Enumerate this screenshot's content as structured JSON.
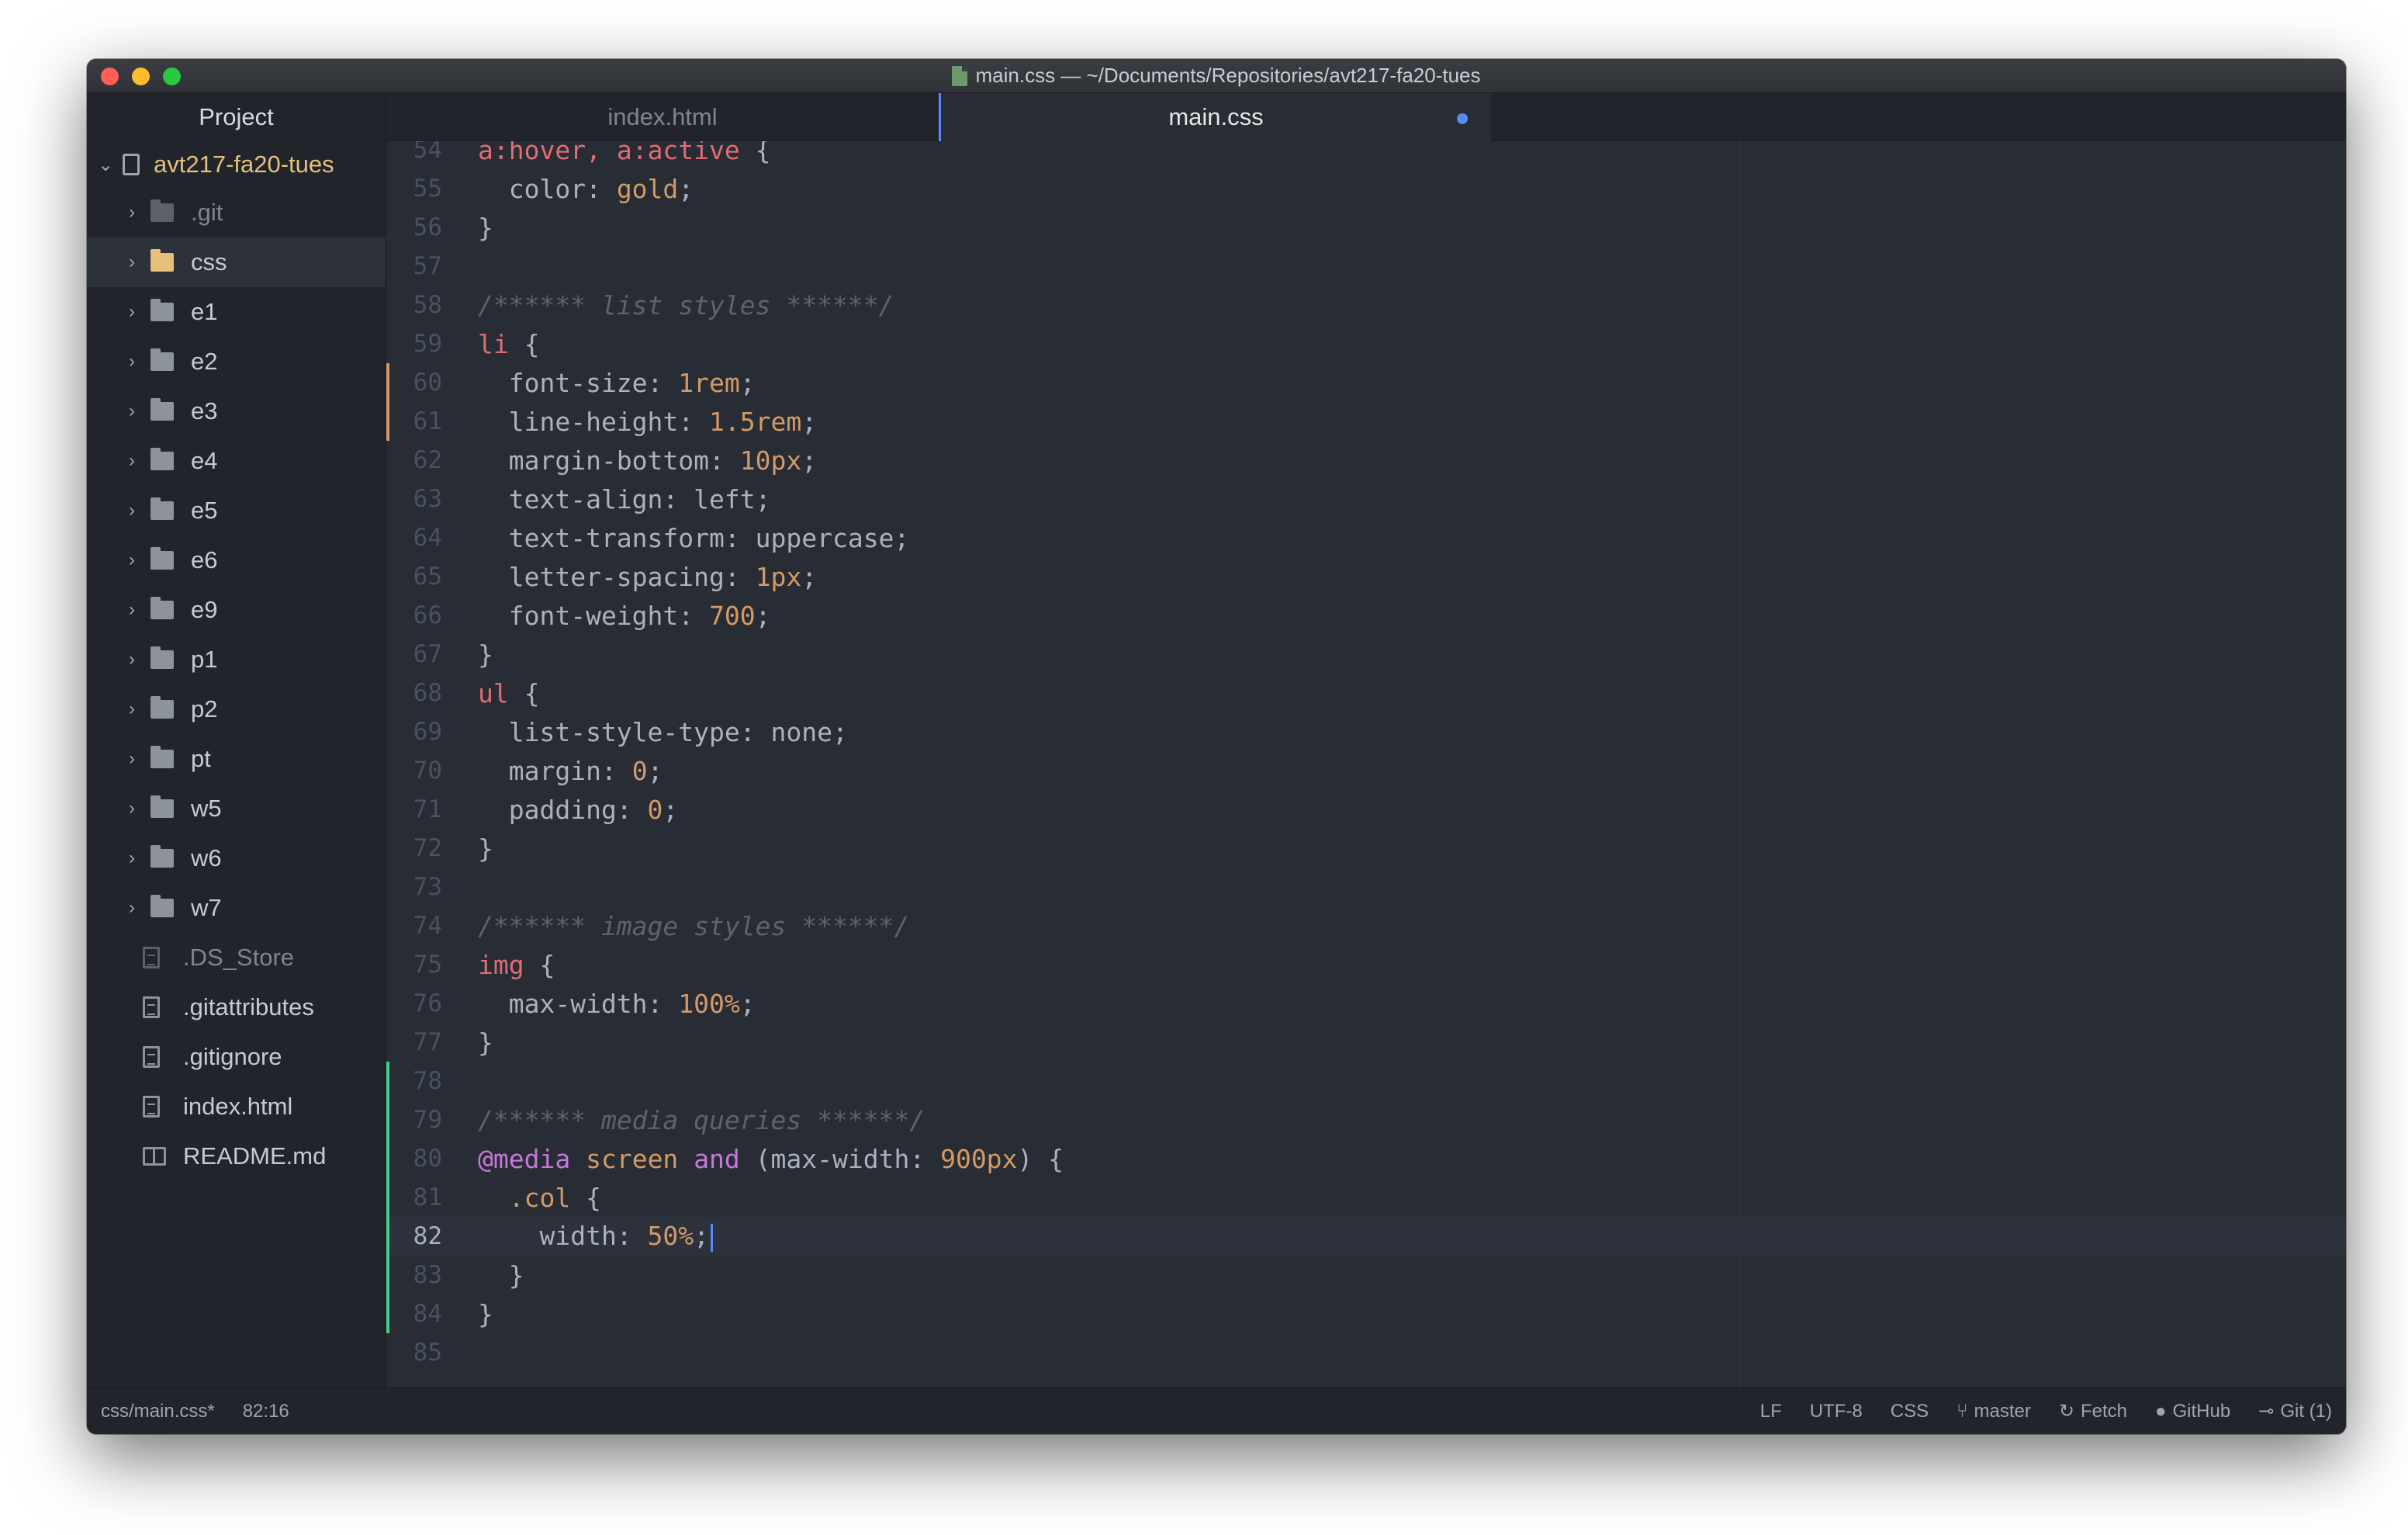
{
  "window": {
    "title": "main.css — ~/Documents/Repositories/avt217-fa20-tues"
  },
  "sidebar": {
    "header": "Project",
    "root": "avt217-fa20-tues",
    "folders": [
      ".git",
      "css",
      "e1",
      "e2",
      "e3",
      "e4",
      "e5",
      "e6",
      "e9",
      "p1",
      "p2",
      "pt",
      "w5",
      "w6",
      "w7"
    ],
    "files": [
      ".DS_Store",
      ".gitattributes",
      ".gitignore",
      "index.html",
      "README.md"
    ]
  },
  "tabs": [
    {
      "label": "index.html"
    },
    {
      "label": "main.css"
    }
  ],
  "editor": {
    "lines": [
      {
        "n": "54",
        "git": "",
        "tokens": [
          {
            "c": "t-sel",
            "t": "a:hover"
          },
          {
            "c": "t-sel",
            "t": ", "
          },
          {
            "c": "t-sel",
            "t": "a:active"
          },
          {
            "c": "",
            "t": " {"
          }
        ]
      },
      {
        "n": "55",
        "git": "",
        "tokens": [
          {
            "c": "",
            "t": "  color: "
          },
          {
            "c": "t-val",
            "t": "gold"
          },
          {
            "c": "",
            "t": ";"
          }
        ]
      },
      {
        "n": "56",
        "git": "",
        "tokens": [
          {
            "c": "",
            "t": "}"
          }
        ]
      },
      {
        "n": "57",
        "git": "",
        "tokens": []
      },
      {
        "n": "58",
        "git": "",
        "tokens": [
          {
            "c": "t-com",
            "t": "/****** list styles ******/"
          }
        ]
      },
      {
        "n": "59",
        "git": "",
        "tokens": [
          {
            "c": "t-sel",
            "t": "li"
          },
          {
            "c": "",
            "t": " {"
          }
        ]
      },
      {
        "n": "60",
        "git": "modified",
        "tokens": [
          {
            "c": "",
            "t": "  font-size: "
          },
          {
            "c": "t-val",
            "t": "1rem"
          },
          {
            "c": "",
            "t": ";"
          }
        ]
      },
      {
        "n": "61",
        "git": "modified",
        "tokens": [
          {
            "c": "",
            "t": "  line-height: "
          },
          {
            "c": "t-val",
            "t": "1.5rem"
          },
          {
            "c": "",
            "t": ";"
          }
        ]
      },
      {
        "n": "62",
        "git": "",
        "tokens": [
          {
            "c": "",
            "t": "  margin-bottom: "
          },
          {
            "c": "t-val",
            "t": "10px"
          },
          {
            "c": "",
            "t": ";"
          }
        ]
      },
      {
        "n": "63",
        "git": "",
        "tokens": [
          {
            "c": "",
            "t": "  text-align: left;"
          }
        ]
      },
      {
        "n": "64",
        "git": "",
        "tokens": [
          {
            "c": "",
            "t": "  text-transform: uppercase;"
          }
        ]
      },
      {
        "n": "65",
        "git": "",
        "tokens": [
          {
            "c": "",
            "t": "  letter-spacing: "
          },
          {
            "c": "t-val",
            "t": "1px"
          },
          {
            "c": "",
            "t": ";"
          }
        ]
      },
      {
        "n": "66",
        "git": "",
        "tokens": [
          {
            "c": "",
            "t": "  font-weight: "
          },
          {
            "c": "t-val",
            "t": "700"
          },
          {
            "c": "",
            "t": ";"
          }
        ]
      },
      {
        "n": "67",
        "git": "",
        "tokens": [
          {
            "c": "",
            "t": "}"
          }
        ]
      },
      {
        "n": "68",
        "git": "",
        "tokens": [
          {
            "c": "t-sel",
            "t": "ul"
          },
          {
            "c": "",
            "t": " {"
          }
        ]
      },
      {
        "n": "69",
        "git": "",
        "tokens": [
          {
            "c": "",
            "t": "  list-style-type: none;"
          }
        ]
      },
      {
        "n": "70",
        "git": "",
        "tokens": [
          {
            "c": "",
            "t": "  margin: "
          },
          {
            "c": "t-val",
            "t": "0"
          },
          {
            "c": "",
            "t": ";"
          }
        ]
      },
      {
        "n": "71",
        "git": "",
        "tokens": [
          {
            "c": "",
            "t": "  padding: "
          },
          {
            "c": "t-val",
            "t": "0"
          },
          {
            "c": "",
            "t": ";"
          }
        ]
      },
      {
        "n": "72",
        "git": "",
        "tokens": [
          {
            "c": "",
            "t": "}"
          }
        ]
      },
      {
        "n": "73",
        "git": "",
        "tokens": []
      },
      {
        "n": "74",
        "git": "",
        "tokens": [
          {
            "c": "t-com",
            "t": "/****** image styles ******/"
          }
        ]
      },
      {
        "n": "75",
        "git": "",
        "tokens": [
          {
            "c": "t-sel",
            "t": "img"
          },
          {
            "c": "",
            "t": " {"
          }
        ]
      },
      {
        "n": "76",
        "git": "",
        "tokens": [
          {
            "c": "",
            "t": "  max-width: "
          },
          {
            "c": "t-val",
            "t": "100%"
          },
          {
            "c": "",
            "t": ";"
          }
        ]
      },
      {
        "n": "77",
        "git": "",
        "tokens": [
          {
            "c": "",
            "t": "}"
          }
        ]
      },
      {
        "n": "78",
        "git": "added",
        "tokens": []
      },
      {
        "n": "79",
        "git": "added",
        "tokens": [
          {
            "c": "t-com",
            "t": "/****** media queries ******/"
          }
        ]
      },
      {
        "n": "80",
        "git": "added",
        "tokens": [
          {
            "c": "t-at",
            "t": "@media"
          },
          {
            "c": "",
            "t": " "
          },
          {
            "c": "t-cls",
            "t": "screen"
          },
          {
            "c": "",
            "t": " "
          },
          {
            "c": "t-kw",
            "t": "and"
          },
          {
            "c": "",
            "t": " (max-width: "
          },
          {
            "c": "t-val",
            "t": "900px"
          },
          {
            "c": "",
            "t": ") {"
          }
        ]
      },
      {
        "n": "81",
        "git": "added",
        "tokens": [
          {
            "c": "",
            "t": "  "
          },
          {
            "c": "t-cls",
            "t": ".col"
          },
          {
            "c": "",
            "t": " {"
          }
        ]
      },
      {
        "n": "82",
        "git": "added",
        "cursor": true,
        "tokens": [
          {
            "c": "",
            "t": "    width: "
          },
          {
            "c": "t-val",
            "t": "50%"
          },
          {
            "c": "",
            "t": ";"
          }
        ]
      },
      {
        "n": "83",
        "git": "added",
        "tokens": [
          {
            "c": "",
            "t": "  }"
          }
        ]
      },
      {
        "n": "84",
        "git": "added",
        "tokens": [
          {
            "c": "",
            "t": "}"
          }
        ]
      },
      {
        "n": "85",
        "git": "",
        "tokens": []
      }
    ]
  },
  "status": {
    "path": "css/main.css*",
    "position": "82:16",
    "line_ending": "LF",
    "encoding": "UTF-8",
    "grammar": "CSS",
    "branch": "master",
    "fetch": "Fetch",
    "github": "GitHub",
    "git": "Git (1)"
  },
  "colors": {
    "accent": "#568af2",
    "git_modified": "#d19a66",
    "git_added": "#43d08a",
    "root_folder": "#e5c07b"
  }
}
